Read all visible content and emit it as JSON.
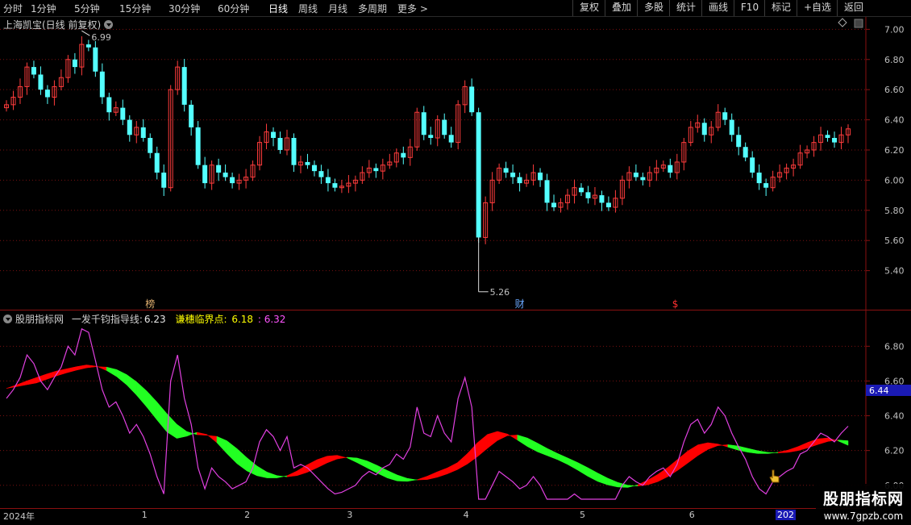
{
  "toolbar": {
    "timeframes": [
      "分时",
      "1分钟",
      "5分钟",
      "15分钟",
      "30分钟",
      "60分钟",
      "日线",
      "周线",
      "月线",
      "多周期",
      "更多 >"
    ],
    "active_timeframe": "日线",
    "right_buttons": [
      "复权",
      "叠加",
      "多股",
      "统计",
      "画线",
      "F10",
      "标记",
      "+自选",
      "返回"
    ]
  },
  "main_chart": {
    "title": "上海凯宝(日线 前复权)",
    "y_ticks": [
      "7.00",
      "6.80",
      "6.60",
      "6.40",
      "6.20",
      "6.00",
      "5.80",
      "5.60",
      "5.40"
    ],
    "y_min": 5.2,
    "y_max": 7.05,
    "high_marker": "6.99",
    "low_marker": "5.26",
    "event_markers": [
      {
        "text": "榜",
        "color": "#e0b070",
        "index": 21
      },
      {
        "text": "财",
        "color": "#6aa8ff",
        "index": 75
      },
      {
        "text": "$",
        "color": "#ff3030",
        "index": 98
      }
    ]
  },
  "indicator": {
    "source": "股朋指标网",
    "name": "一发千钧指导线:",
    "value1": "6.23",
    "label2": "谦穗临界点:",
    "value2": "6.18",
    "value3": ": 6.32",
    "y_ticks": [
      "6.80",
      "6.60",
      "6.40",
      "6.20",
      "6.00"
    ],
    "y_min": 5.92,
    "y_max": 6.95,
    "current_price_tag": "6.44"
  },
  "date_axis": {
    "labels": [
      {
        "text": "2024年",
        "index": 0
      },
      {
        "text": "1",
        "index": 20
      },
      {
        "text": "2",
        "index": 35
      },
      {
        "text": "3",
        "index": 50
      },
      {
        "text": "4",
        "index": 67
      },
      {
        "text": "5",
        "index": 84
      },
      {
        "text": "6",
        "index": 100
      }
    ],
    "end_label": "202"
  },
  "watermark": {
    "line1": "股朋指标网",
    "line2": "www.7gpzb.com"
  },
  "colors": {
    "up": "#ff3c3c",
    "down": "#54ffff",
    "band_up": "#ff0000",
    "band_down": "#22ff22",
    "line_purple": "#e040e0"
  },
  "chart_data": {
    "type": "candlestick",
    "series_name": "上海凯宝",
    "close": [
      6.5,
      6.55,
      6.62,
      6.75,
      6.7,
      6.6,
      6.55,
      6.62,
      6.68,
      6.8,
      6.75,
      6.9,
      6.88,
      6.72,
      6.55,
      6.45,
      6.48,
      6.4,
      6.3,
      6.35,
      6.28,
      6.18,
      6.05,
      5.95,
      6.6,
      6.75,
      6.5,
      6.35,
      6.1,
      5.98,
      6.1,
      6.05,
      6.02,
      5.98,
      6.0,
      6.02,
      6.1,
      6.25,
      6.32,
      6.28,
      6.2,
      6.28,
      6.1,
      6.12,
      6.1,
      6.06,
      6.02,
      5.98,
      5.95,
      5.96,
      5.98,
      6.0,
      6.05,
      6.08,
      6.06,
      6.1,
      6.12,
      6.18,
      6.15,
      6.22,
      6.45,
      6.3,
      6.28,
      6.4,
      6.3,
      6.25,
      6.5,
      6.62,
      6.45,
      5.62,
      5.85,
      6.0,
      6.08,
      6.05,
      6.02,
      5.98,
      6.0,
      6.05,
      6.0,
      5.85,
      5.82,
      5.85,
      5.9,
      5.95,
      5.92,
      5.88,
      5.9,
      5.85,
      5.82,
      5.88,
      6.0,
      6.05,
      6.02,
      6.0,
      6.05,
      6.08,
      6.1,
      6.05,
      6.12,
      6.25,
      6.35,
      6.38,
      6.3,
      6.35,
      6.45,
      6.4,
      6.3,
      6.22,
      6.15,
      6.05,
      5.98,
      5.95,
      6.02,
      6.05,
      6.08,
      6.1,
      6.18,
      6.2,
      6.25,
      6.3,
      6.28,
      6.25,
      6.3,
      6.34
    ],
    "ma_line": [
      6.55,
      6.58,
      6.6,
      6.62,
      6.64,
      6.66,
      6.67,
      6.68,
      6.7,
      6.69,
      6.66,
      6.63,
      6.58,
      6.52,
      6.45,
      6.38,
      6.3,
      6.25,
      6.28,
      6.32,
      6.3,
      6.25,
      6.18,
      6.12,
      6.08,
      6.05,
      6.04,
      6.04,
      6.05,
      6.08,
      6.12,
      6.15,
      6.17,
      6.18,
      6.16,
      6.13,
      6.1,
      6.07,
      6.04,
      6.02,
      6.02,
      6.03,
      6.05,
      6.08,
      6.1,
      6.12,
      6.18,
      6.25,
      6.3,
      6.32,
      6.3,
      6.26,
      6.22,
      6.19,
      6.17,
      6.15,
      6.12,
      6.09,
      6.05,
      6.02,
      6.0,
      5.99,
      5.98,
      6.0,
      6.03,
      6.06,
      6.1,
      6.15,
      6.2,
      6.24,
      6.25,
      6.24,
      6.22,
      6.2,
      6.19,
      6.18,
      6.18,
      6.19,
      6.2,
      6.22,
      6.25,
      6.27,
      6.28,
      6.26,
      6.22
    ],
    "x_labels": [
      "2024年",
      "1",
      "2",
      "3",
      "4",
      "5",
      "6"
    ]
  }
}
